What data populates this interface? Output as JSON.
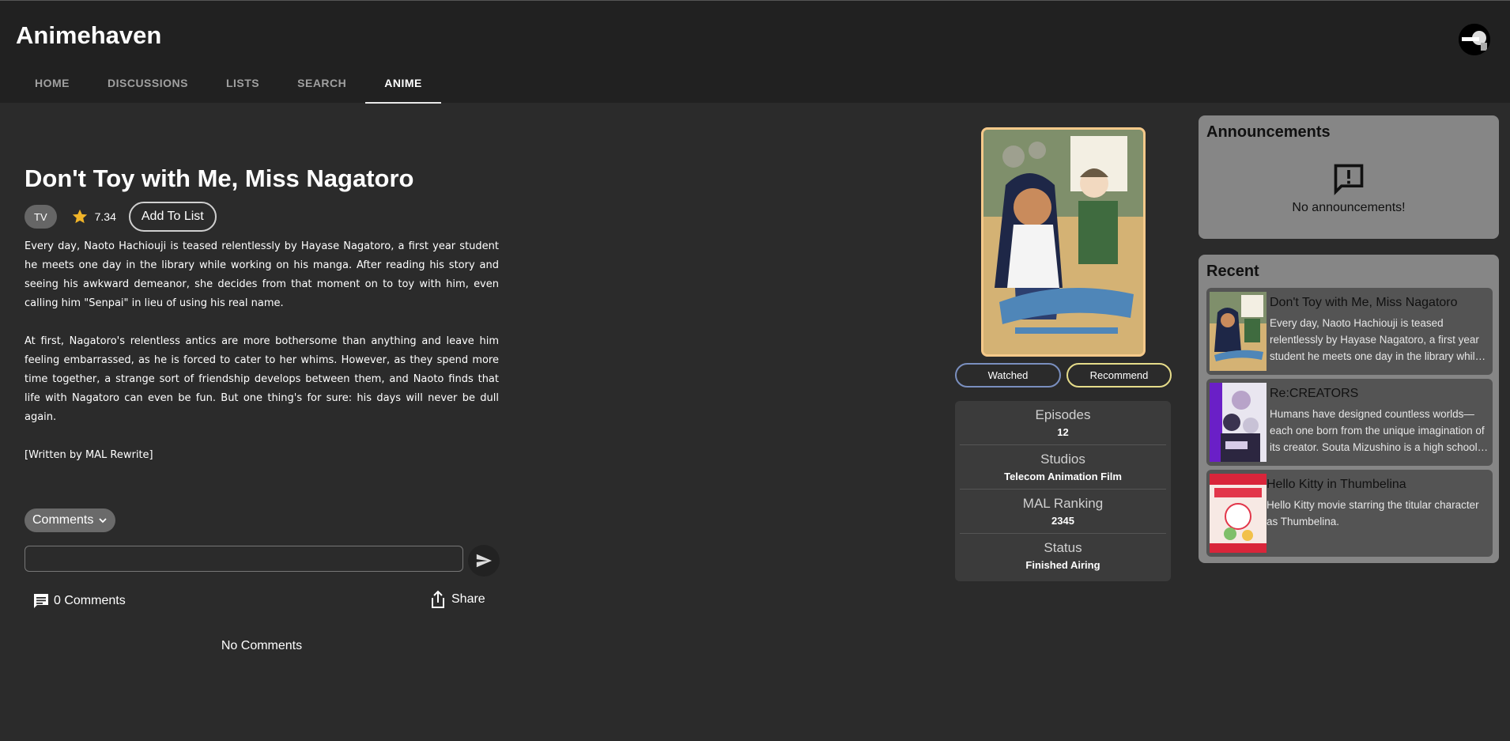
{
  "app": {
    "title": "Animehaven"
  },
  "nav": {
    "tabs": [
      "HOME",
      "DISCUSSIONS",
      "LISTS",
      "SEARCH",
      "ANIME"
    ],
    "active": "ANIME"
  },
  "anime": {
    "title": "Don't Toy with Me, Miss Nagatoro",
    "type": "TV",
    "score": "7.34",
    "add_to_list_label": "Add To List",
    "synopsis": [
      "Every day, Naoto Hachiouji is teased relentlessly by Hayase Nagatoro, a first year student he meets one day in the library while working on his manga. After reading his story and seeing his awkward demeanor, she decides from that moment on to toy with him, even calling him \"Senpai\" in lieu of using his real name.",
      "At first, Nagatoro's relentless antics are more bothersome than anything and leave him feeling embarrassed, as he is forced to cater to her whims. However, as they spend more time together, a strange sort of friendship develops between them, and Naoto finds that life with Nagatoro can even be fun. But one thing's for sure: his days will never be dull again.",
      "[Written by MAL Rewrite]"
    ],
    "watched_label": "Watched",
    "recommend_label": "Recommend",
    "info": [
      {
        "label": "Episodes",
        "value": "12"
      },
      {
        "label": "Studios",
        "value": "Telecom Animation Film"
      },
      {
        "label": "MAL Ranking",
        "value": "2345"
      },
      {
        "label": "Status",
        "value": "Finished Airing"
      }
    ]
  },
  "comments": {
    "selector_label": "Comments",
    "input_value": "",
    "count_label": "0 Comments",
    "share_label": "Share",
    "empty_label": "No Comments"
  },
  "announcements": {
    "title": "Announcements",
    "empty_text": "No announcements!"
  },
  "recent": {
    "title": "Recent",
    "items": [
      {
        "title": "Don't Toy with Me, Miss Nagatoro",
        "description": "Every day, Naoto Hachiouji is teased relentlessly by Hayase Nagatoro, a first year student he meets one day in the library while working on his manga."
      },
      {
        "title": "Re:CREATORS",
        "description": "Humans have designed countless worlds—each one born from the unique imagination of its creator. Souta Mizushino is a high school student who dreams of becoming a creator."
      },
      {
        "title": "Hello Kitty in Thumbelina",
        "description": "Hello Kitty movie starring the titular character as Thumbelina."
      }
    ]
  },
  "icons": {
    "star": "star-icon",
    "announcement": "announcement-icon",
    "send": "send-icon",
    "comment": "comment-icon",
    "share": "share-icon",
    "chevron": "chevron-down-icon"
  },
  "colors": {
    "header_bg": "#212121",
    "page_bg": "#2b2b2b",
    "card_bg": "#868686",
    "star": "#f0b429",
    "watched_border": "#7a8fbf",
    "recommend_border": "#e6dc8a",
    "poster_border": "#f5c98a"
  }
}
